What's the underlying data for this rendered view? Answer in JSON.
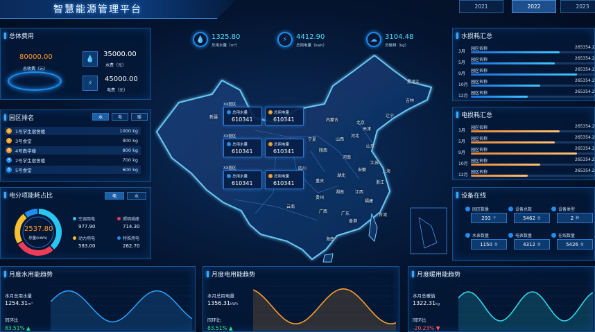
{
  "header": {
    "title": "智慧能源管理平台",
    "years": [
      "2021",
      "2022",
      "2023"
    ],
    "active_year": "2022"
  },
  "total_cost": {
    "title": "总体费用",
    "total_value": "80000.00",
    "total_label": "总收费（元）",
    "water_value": "35000.00",
    "water_label": "水费（元）",
    "electric_value": "45000.00",
    "electric_label": "电费（元）"
  },
  "ranking": {
    "title": "园区排名",
    "tabs": [
      "水",
      "电",
      "暖"
    ],
    "rows": [
      {
        "num": "1",
        "name": "1号学生宿舍楼",
        "value": "1000 kg",
        "color": "#f5a020"
      },
      {
        "num": "2",
        "name": "3号食堂",
        "value": "900 kg",
        "color": "#f5a020"
      },
      {
        "num": "3",
        "name": "4号教学楼",
        "value": "800 kg",
        "color": "#f5a020"
      },
      {
        "num": "4",
        "name": "2号学生宿舍楼",
        "value": "700 kg",
        "color": "#1f8ef0"
      },
      {
        "num": "5",
        "name": "5号食堂",
        "value": "600 kg",
        "color": "#1f8ef0"
      }
    ]
  },
  "sub_item": {
    "title": "电分项能耗占比",
    "tabs": [
      "电",
      "水"
    ],
    "center_value": "2537.80",
    "center_label": "总量(kWh)",
    "donut": [
      {
        "name": "空调用电",
        "value": 977.9,
        "display": "977.90",
        "color": "#28c6f2"
      },
      {
        "name": "照明插座",
        "value": 714.3,
        "display": "714.30",
        "color": "#ef3b5a"
      },
      {
        "name": "动力用电",
        "value": 583.0,
        "display": "583.00",
        "color": "#f7c032"
      },
      {
        "name": "特殊用电",
        "value": 262.7,
        "display": "262.70",
        "color": "#1f8ef0"
      }
    ]
  },
  "top_stats": [
    {
      "value": "1325.80",
      "label": "总用水量（m³）",
      "icon": "💧"
    },
    {
      "value": "4412.90",
      "label": "总用电量（kwh）",
      "icon": "⚡"
    },
    {
      "value": "3104.48",
      "label": "总碳排（kg）",
      "icon": "☁"
    }
  ],
  "map": {
    "regions": [
      {
        "title": "XX园区",
        "water_label": "总用水量",
        "water_value": "610341",
        "power_label": "总用电量",
        "power_value": "610341"
      },
      {
        "title": "XX园区",
        "water_label": "总用水量",
        "water_value": "610341",
        "power_label": "总用电量",
        "power_value": "610341"
      },
      {
        "title": "XX园区",
        "water_label": "总用水量",
        "water_value": "610341",
        "power_label": "总用电量",
        "power_value": "610341"
      }
    ],
    "provinces": [
      "黑龙江",
      "吉林",
      "辽宁",
      "内蒙古",
      "北京",
      "天津",
      "河北",
      "山西",
      "山东",
      "宁夏",
      "陕西",
      "河南",
      "江苏",
      "安徽",
      "上海",
      "湖北",
      "浙江",
      "四川",
      "重庆",
      "湖南",
      "江西",
      "福建",
      "贵州",
      "云南",
      "广西",
      "广东",
      "香港",
      "台湾",
      "海南",
      "新疆"
    ]
  },
  "water_summary": {
    "title": "水损耗汇总",
    "rows": [
      {
        "month": "3月",
        "name": "园区名称",
        "value": "265354.2",
        "pct": 0.72
      },
      {
        "month": "5月",
        "name": "园区名称",
        "value": "265354.2",
        "pct": 0.68
      },
      {
        "month": "9月",
        "name": "园区名称",
        "value": "265354.2",
        "pct": 0.86
      },
      {
        "month": "10月",
        "name": "园区名称",
        "value": "265354.2",
        "pct": 0.56
      },
      {
        "month": "12月",
        "name": "园区名称",
        "value": "265354.2",
        "pct": 0.46
      }
    ]
  },
  "power_summary": {
    "title": "电损耗汇总",
    "rows": [
      {
        "month": "3月",
        "name": "园区名称",
        "value": "265354.2",
        "pct": 0.72
      },
      {
        "month": "5月",
        "name": "园区名称",
        "value": "265354.2",
        "pct": 0.68
      },
      {
        "month": "9月",
        "name": "园区名称",
        "value": "265354.2",
        "pct": 0.86
      },
      {
        "month": "10月",
        "name": "园区名称",
        "value": "265354.2",
        "pct": 0.56
      },
      {
        "month": "12月",
        "name": "园区名称",
        "value": "265354.2",
        "pct": 0.46
      }
    ]
  },
  "devices": {
    "title": "设备在线",
    "items": [
      {
        "label": "园区数量",
        "value": "293",
        "unit": "个"
      },
      {
        "label": "设备总数",
        "value": "5462",
        "unit": "台"
      },
      {
        "label": "设备类型",
        "value": "2",
        "unit": "种"
      },
      {
        "label": "水表数量",
        "value": "1150",
        "unit": "台"
      },
      {
        "label": "电表数量",
        "value": "4312",
        "unit": "台"
      },
      {
        "label": "在线数量",
        "value": "5426",
        "unit": "台"
      }
    ]
  },
  "trends": [
    {
      "title": "月度水用能趋势",
      "total_label": "本月总用水量",
      "total_value": "1254.31",
      "total_unit": "m³",
      "ratio_label": "同环比",
      "ratio_value": "83.51% ▲",
      "ratio_color": "#2fe08a",
      "line_color": "#2a9df4"
    },
    {
      "title": "月度电用能趋势",
      "total_label": "本月总用电量",
      "total_value": "1356.31",
      "total_unit": "kWh",
      "ratio_label": "同环比",
      "ratio_value": "83.51% ▲",
      "ratio_color": "#2fe08a",
      "line_color": "#f5a030"
    },
    {
      "title": "月度暖用能趋势",
      "total_label": "本月总暖值",
      "total_value": "1322.31",
      "total_unit": "kg",
      "ratio_label": "同环比",
      "ratio_value": "-20.23% ▼",
      "ratio_color": "#ff5a5a",
      "line_color": "#2fd8e8"
    }
  ]
}
